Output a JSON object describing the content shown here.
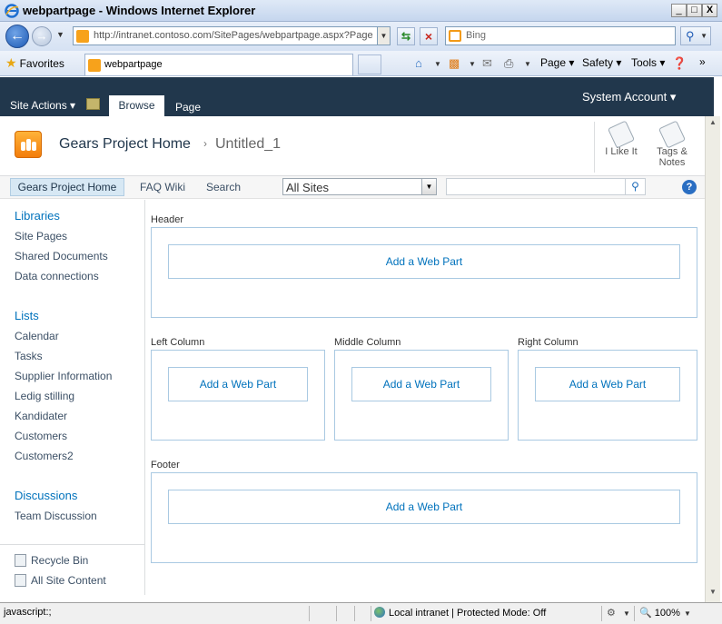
{
  "window": {
    "title": "webpartpage - Windows Internet Explorer",
    "minimize": "_",
    "maximize": "□",
    "close": "X"
  },
  "address": {
    "url": "http://intranet.contoso.com/SitePages/webpartpage.aspx?Page",
    "search_placeholder": "Bing"
  },
  "favbar": {
    "favorites_label": "Favorites",
    "tab_title": "webpartpage",
    "commands": [
      "Page",
      "Safety",
      "Tools"
    ]
  },
  "ribbon": {
    "site_actions": "Site Actions",
    "tab_browse": "Browse",
    "tab_page": "Page",
    "account": "System Account"
  },
  "titlearea": {
    "site_title": "Gears Project Home",
    "separator": "›",
    "page_title": "Untitled_1",
    "i_like_it": "I Like It",
    "tags_notes_1": "Tags &",
    "tags_notes_2": "Notes"
  },
  "topnav": {
    "items": [
      "Gears Project Home",
      "FAQ Wiki",
      "Search"
    ],
    "scope": "All Sites",
    "search_value": ""
  },
  "quicklaunch": {
    "libraries": {
      "heading": "Libraries",
      "items": [
        "Site Pages",
        "Shared Documents",
        "Data connections"
      ]
    },
    "lists": {
      "heading": "Lists",
      "items": [
        "Calendar",
        "Tasks",
        "Supplier Information",
        "Ledig stilling",
        "Kandidater",
        "Customers",
        "Customers2"
      ]
    },
    "discussions": {
      "heading": "Discussions",
      "items": [
        "Team Discussion"
      ]
    },
    "recycle_bin": "Recycle Bin",
    "all_site_content": "All Site Content"
  },
  "zones": {
    "header": "Header",
    "left": "Left Column",
    "middle": "Middle Column",
    "right": "Right Column",
    "footer": "Footer",
    "add_web_part": "Add a Web Part"
  },
  "status": {
    "left": "javascript:;",
    "zone": "Local intranet | Protected Mode: Off",
    "zoom": "100%"
  },
  "colors": {
    "ribbon_bg": "#21374c",
    "link": "#0072bc",
    "zone_border": "#a9c9e2",
    "nav_selected": "#d7e8f4"
  }
}
